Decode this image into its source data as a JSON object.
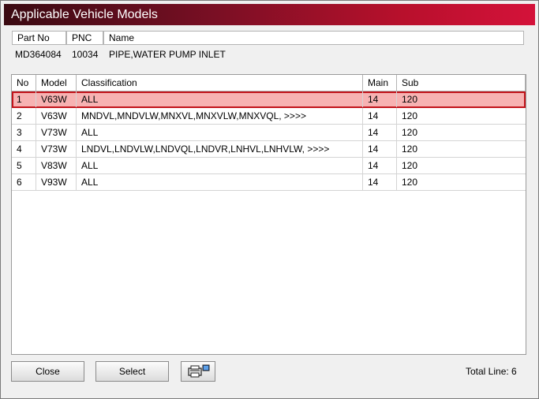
{
  "window": {
    "title": "Applicable Vehicle Models"
  },
  "part_info": {
    "headers": {
      "part_no": "Part No",
      "pnc": "PNC",
      "name": "Name"
    },
    "values": {
      "part_no": "MD364084",
      "pnc": "10034",
      "name": "PIPE,WATER PUMP INLET"
    }
  },
  "grid": {
    "headers": {
      "no": "No",
      "model": "Model",
      "classification": "Classification",
      "main": "Main",
      "sub": "Sub"
    },
    "rows": [
      {
        "no": "1",
        "model": "V63W",
        "classification": "ALL",
        "main": "14",
        "sub": "120",
        "selected": true
      },
      {
        "no": "2",
        "model": "V63W",
        "classification": "MNDVL,MNDVLW,MNXVL,MNXVLW,MNXVQL,  >>>>",
        "main": "14",
        "sub": "120",
        "selected": false
      },
      {
        "no": "3",
        "model": "V73W",
        "classification": "ALL",
        "main": "14",
        "sub": "120",
        "selected": false
      },
      {
        "no": "4",
        "model": "V73W",
        "classification": "LNDVL,LNDVLW,LNDVQL,LNDVR,LNHVL,LNHVLW,  >>>>",
        "main": "14",
        "sub": "120",
        "selected": false
      },
      {
        "no": "5",
        "model": "V83W",
        "classification": "ALL",
        "main": "14",
        "sub": "120",
        "selected": false
      },
      {
        "no": "6",
        "model": "V93W",
        "classification": "ALL",
        "main": "14",
        "sub": "120",
        "selected": false
      }
    ]
  },
  "footer": {
    "close_label": "Close",
    "select_label": "Select",
    "print_icon": "printer-icon",
    "total_label": "Total Line: 6"
  },
  "colors": {
    "title_dark": "#3a0a12",
    "title_bright": "#d4123a",
    "selected_fill": "#f7b2b2",
    "selected_border": "#c2141b"
  }
}
